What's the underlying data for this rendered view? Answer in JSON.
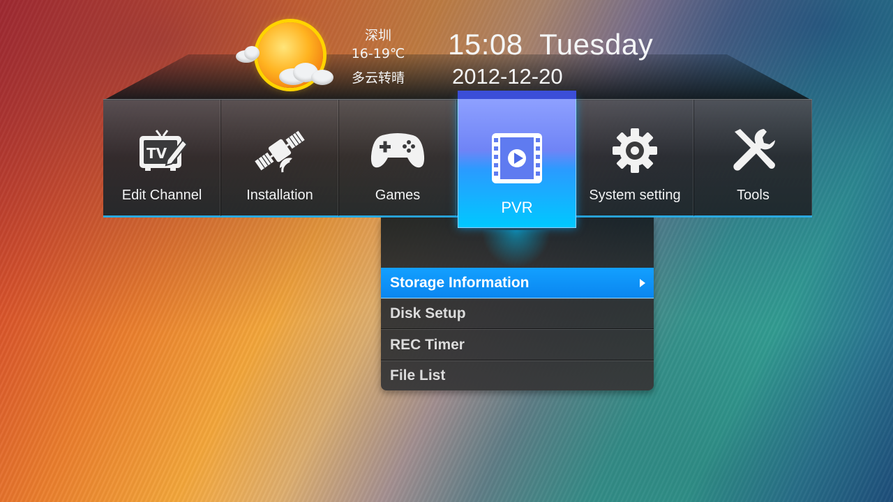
{
  "weather": {
    "city": "深圳",
    "temperature": "16-19℃",
    "condition": "多云转晴",
    "icon": "partly-cloudy-sun-icon"
  },
  "clock": {
    "time": "15:08",
    "weekday": "Tuesday",
    "time_display": "15:08  Tuesday",
    "date": "2012-12-20"
  },
  "main_menu": {
    "items": [
      {
        "label": "Edit Channel",
        "icon": "tv-edit-icon"
      },
      {
        "label": "Installation",
        "icon": "satellite-icon"
      },
      {
        "label": "Games",
        "icon": "gamepad-icon"
      },
      {
        "label": "PVR",
        "icon": "film-play-icon",
        "active": true
      },
      {
        "label": "System setting",
        "icon": "gear-icon"
      },
      {
        "label": "Tools",
        "icon": "tools-icon"
      }
    ]
  },
  "submenu": {
    "items": [
      {
        "label": "Storage Information",
        "selected": true
      },
      {
        "label": "Disk Setup"
      },
      {
        "label": "REC Timer"
      },
      {
        "label": "File List"
      }
    ]
  },
  "colors": {
    "accent": "#0a86f0",
    "active_tile_top": "#8ea0ff",
    "active_tile_bottom": "#00c8ff"
  }
}
